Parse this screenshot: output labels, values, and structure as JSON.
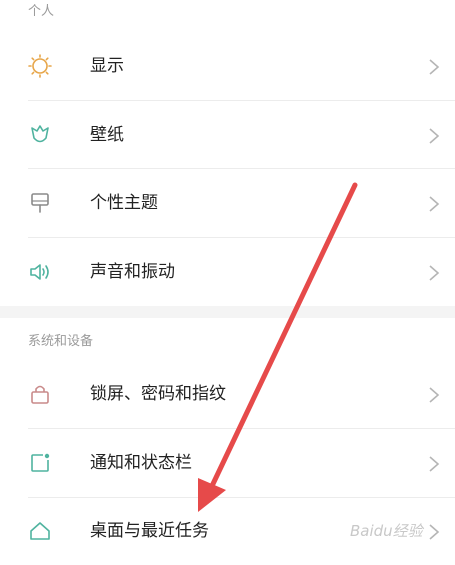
{
  "sections": [
    {
      "title": "个人",
      "items": [
        {
          "label": "显示",
          "icon": "sun-icon"
        },
        {
          "label": "壁纸",
          "icon": "wallpaper-icon"
        },
        {
          "label": "个性主题",
          "icon": "brush-icon"
        },
        {
          "label": "声音和振动",
          "icon": "speaker-icon"
        }
      ]
    },
    {
      "title": "系统和设备",
      "items": [
        {
          "label": "锁屏、密码和指纹",
          "icon": "lock-icon"
        },
        {
          "label": "通知和状态栏",
          "icon": "notification-icon"
        },
        {
          "label": "桌面与最近任务",
          "icon": "home-icon"
        }
      ]
    }
  ],
  "watermark": "Baidu经验",
  "colors": {
    "icon_orange": "#e7a64a",
    "icon_teal": "#4fb39f",
    "arrow_red": "#e64a4a"
  }
}
